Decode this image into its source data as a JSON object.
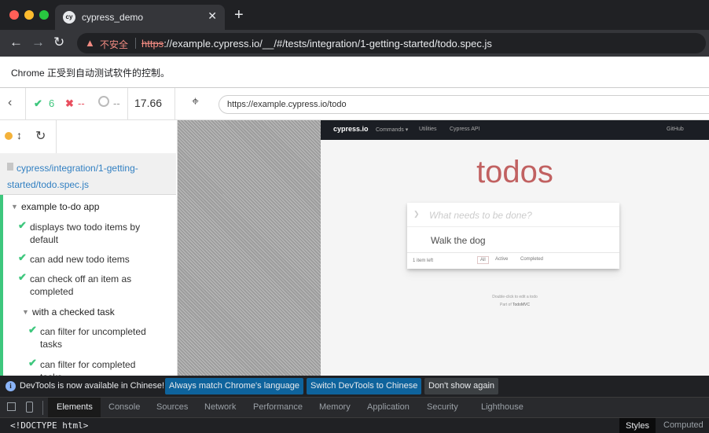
{
  "window": {
    "tab_title": "cypress_demo",
    "tab_favicon": "cy",
    "traffic_light_colors": [
      "#ff5f57",
      "#febc2e",
      "#28c840"
    ]
  },
  "toolbar": {
    "insecure_label": "不安全",
    "url_scheme": "https",
    "url_rest": "://example.cypress.io/__/#/tests/integration/1-getting-started/todo.spec.js"
  },
  "infobar": {
    "text": "Chrome 正受到自动测试软件的控制。"
  },
  "cypress": {
    "passed": "6",
    "failed": "--",
    "pending": "--",
    "duration": "17.66",
    "aut_url": "https://example.cypress.io/todo",
    "colors": {
      "pass": "#3ec77d",
      "fail": "#e94f5f",
      "running": "#f4b23a",
      "link": "#3280c2"
    }
  },
  "reporter": {
    "spec_path": "cypress/integration/1-getting-started/todo.spec.js",
    "suite_title": "example to-do app",
    "tests": [
      "displays two todo items by default",
      "can add new todo items",
      "can check off an item as completed"
    ],
    "nested_suite_title": "with a checked task",
    "nested_tests": [
      "can filter for uncompleted tasks",
      "can filter for completed tasks"
    ]
  },
  "app": {
    "brand": "cypress.io",
    "nav": [
      "Commands ▾",
      "Utilities",
      "Cypress API"
    ],
    "nav_right": "GitHub",
    "title": "todos",
    "input_placeholder": "What needs to be done?",
    "todos": [
      "Walk the dog"
    ],
    "items_left": "1 item left",
    "filters": [
      "All",
      "Active",
      "Completed"
    ],
    "info_line1": "Double-click to edit a todo",
    "info_line2_prefix": "Part of ",
    "info_line2_link": "TodoMVC"
  },
  "devtools": {
    "info_text": "DevTools is now available in Chinese!",
    "btn_match": "Always match Chrome's language",
    "btn_switch": "Switch DevTools to Chinese",
    "btn_dismiss": "Don't show again",
    "tabs": [
      "Elements",
      "Console",
      "Sources",
      "Network",
      "Performance",
      "Memory",
      "Application",
      "Security",
      "Lighthouse"
    ],
    "doctype": "<!DOCTYPE html>",
    "side_tabs": [
      "Styles",
      "Computed"
    ],
    "button_color": "#0e639c"
  }
}
